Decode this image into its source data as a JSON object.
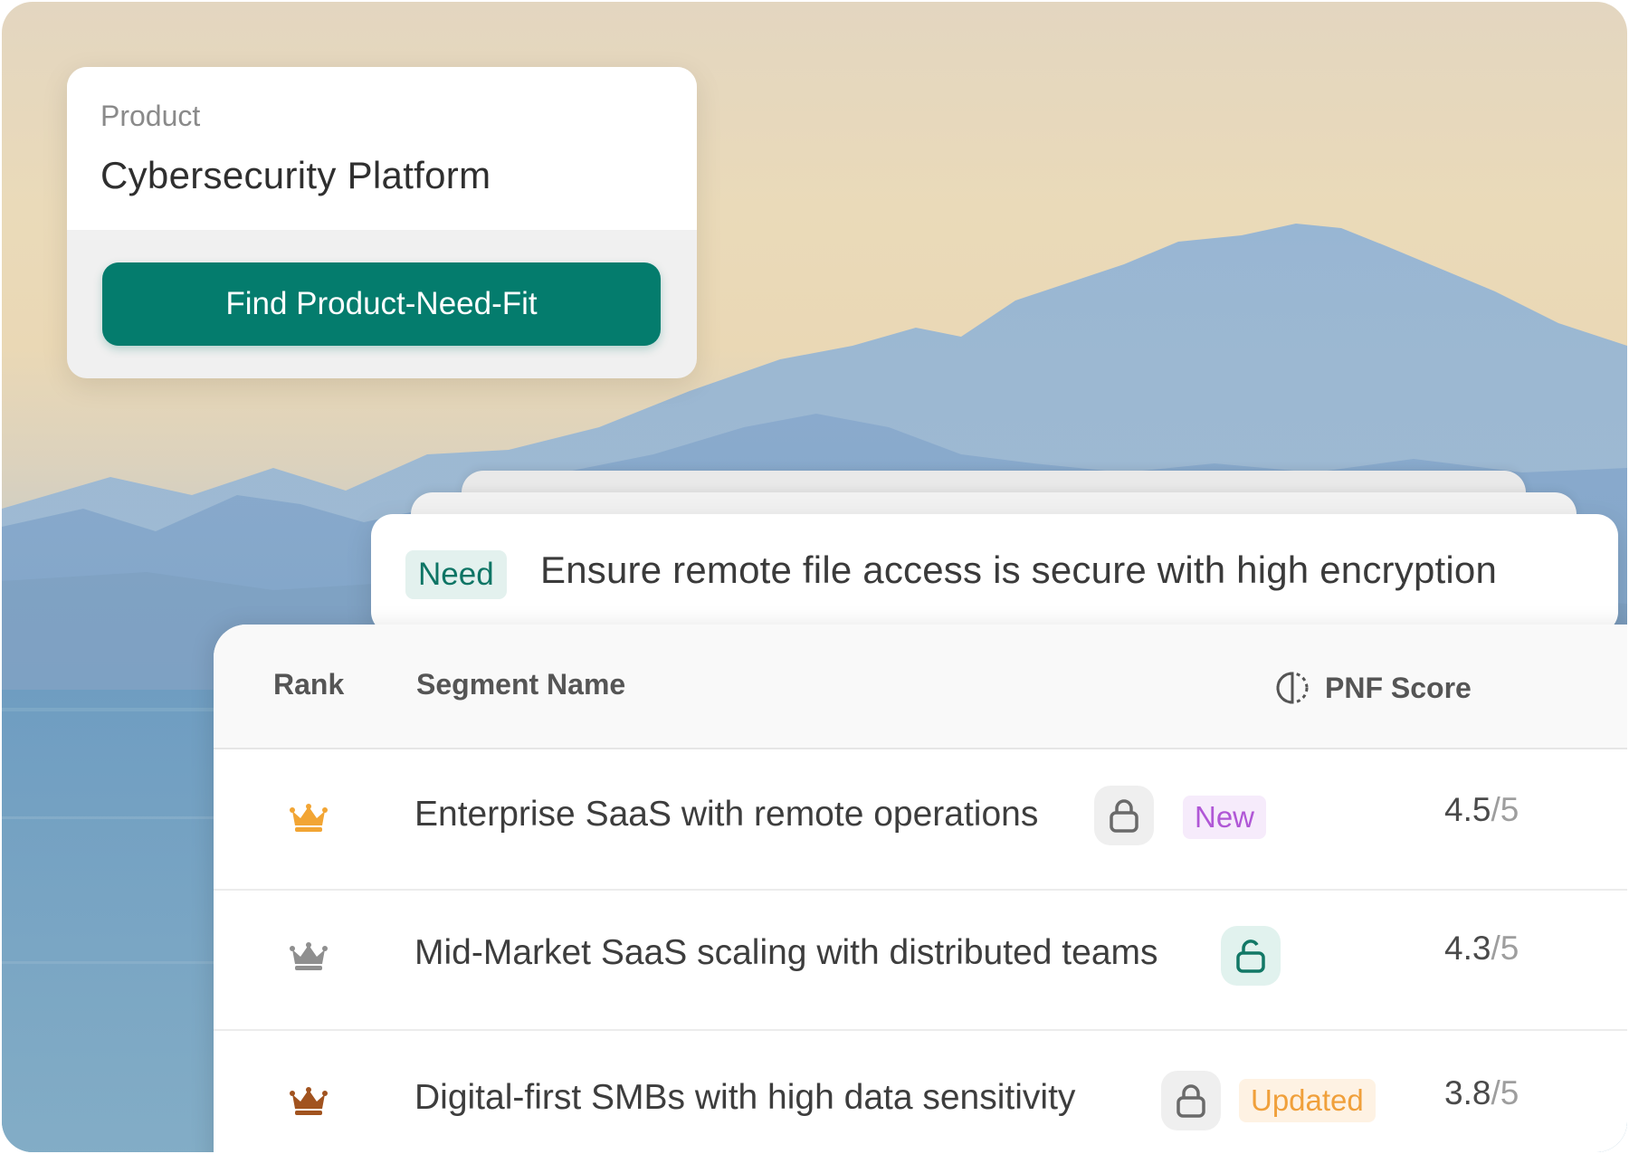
{
  "product_card": {
    "label": "Product",
    "value": "Cybersecurity Platform",
    "button_label": "Find Product-Need-Fit"
  },
  "need_card": {
    "badge": "Need",
    "text": "Ensure remote file access is secure with high encryption"
  },
  "table": {
    "headers": {
      "rank": "Rank",
      "segment": "Segment Name",
      "score": "PNF Score",
      "score_icon": "half-circle-icon"
    },
    "rows": [
      {
        "crown_color": "#f2a534",
        "crown_icon": "crown-gold-icon",
        "name": "Enterprise SaaS with remote operations",
        "lock_state": "locked",
        "tag": "New",
        "score": "4.5",
        "score_max": "/5"
      },
      {
        "crown_color": "#8f8f8f",
        "crown_icon": "crown-silver-icon",
        "name": "Mid-Market SaaS scaling with distributed teams",
        "lock_state": "unlocked",
        "tag": "",
        "score": "4.3",
        "score_max": "/5"
      },
      {
        "crown_color": "#a1531f",
        "crown_icon": "crown-bronze-icon",
        "name": "Digital-first SMBs with high data sensitivity",
        "lock_state": "locked",
        "tag": "Updated",
        "score": "3.8",
        "score_max": "/5"
      }
    ]
  },
  "colors": {
    "brand_green": "#047c6d",
    "need_badge_bg": "#e3f1ee",
    "tag_new_text": "#b057d6",
    "tag_updated_text": "#f0a03b"
  }
}
